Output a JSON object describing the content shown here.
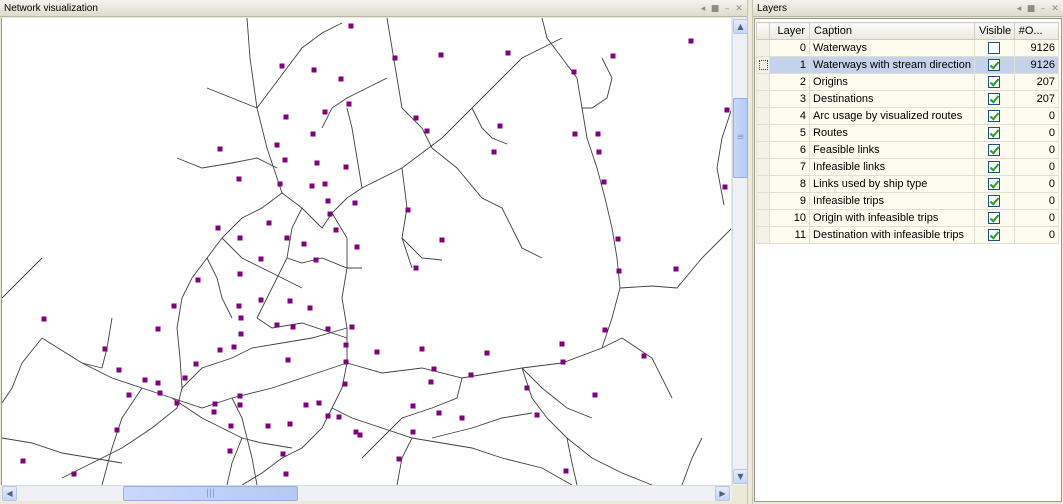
{
  "network_panel": {
    "title": "Network visualization",
    "ctrl_icons": [
      "pin-icon",
      "float-icon",
      "minimize-icon",
      "close-icon"
    ]
  },
  "layers_panel": {
    "title": "Layers",
    "columns": [
      "Layer",
      "Caption",
      "Visible",
      "#O..."
    ],
    "rows": [
      {
        "layer": "0",
        "caption": "Waterways",
        "visible": false,
        "count": "9126"
      },
      {
        "layer": "1",
        "caption": "Waterways with stream direction",
        "visible": true,
        "count": "9126",
        "selected": true
      },
      {
        "layer": "2",
        "caption": "Origins",
        "visible": true,
        "count": "207"
      },
      {
        "layer": "3",
        "caption": "Destinations",
        "visible": true,
        "count": "207"
      },
      {
        "layer": "4",
        "caption": "Arc usage by visualized routes",
        "visible": true,
        "count": "0"
      },
      {
        "layer": "5",
        "caption": "Routes",
        "visible": true,
        "count": "0"
      },
      {
        "layer": "6",
        "caption": "Feasible links",
        "visible": true,
        "count": "0"
      },
      {
        "layer": "7",
        "caption": "Infeasible links",
        "visible": true,
        "count": "0"
      },
      {
        "layer": "8",
        "caption": "Links used by ship type",
        "visible": true,
        "count": "0"
      },
      {
        "layer": "9",
        "caption": "Infeasible trips",
        "visible": true,
        "count": "0"
      },
      {
        "layer": "10",
        "caption": "Origin with infeasible trips",
        "visible": true,
        "count": "0"
      },
      {
        "layer": "11",
        "caption": "Destination with infeasible trips",
        "visible": true,
        "count": "0"
      }
    ]
  },
  "colors": {
    "node": "#800080",
    "edge": "#404040",
    "selection": "#c4d2eb",
    "check": "#21a121"
  }
}
